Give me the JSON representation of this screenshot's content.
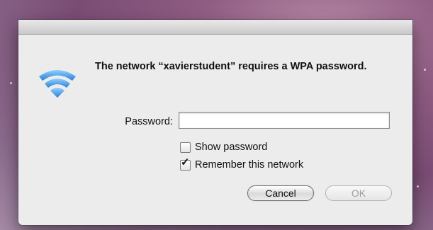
{
  "dialog": {
    "message": "The network “xavierstudent” requires a WPA password.",
    "password_label": "Password:",
    "password_value": "",
    "show_password_label": "Show password",
    "show_password_checked": false,
    "remember_label": "Remember this network",
    "remember_checked": true,
    "cancel_label": "Cancel",
    "ok_label": "OK",
    "icon": "wifi-icon"
  },
  "colors": {
    "wifi_blue": "#3b8fe0",
    "dialog_bg": "#ececec",
    "desktop": "#8f5c83"
  }
}
